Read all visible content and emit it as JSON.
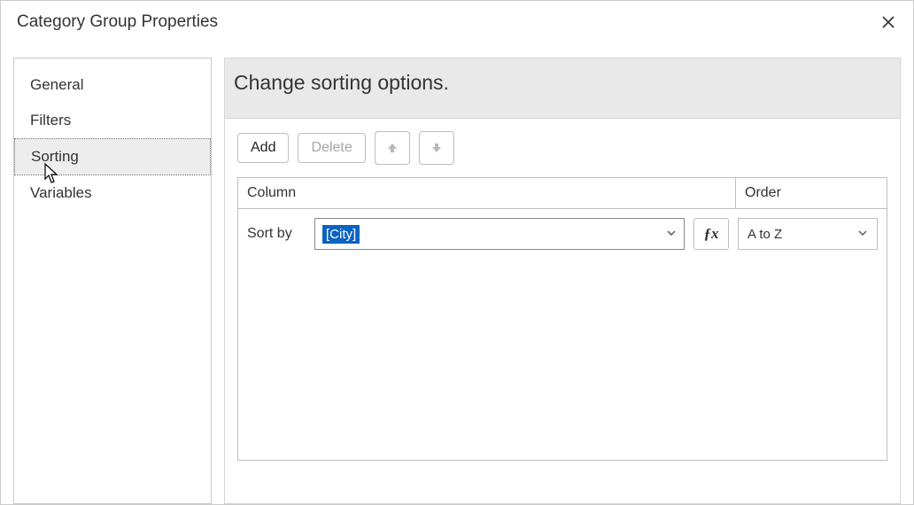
{
  "dialog": {
    "title": "Category Group Properties"
  },
  "sidebar": {
    "items": [
      {
        "label": "General",
        "selected": false
      },
      {
        "label": "Filters",
        "selected": false
      },
      {
        "label": "Sorting",
        "selected": true
      },
      {
        "label": "Variables",
        "selected": false
      }
    ]
  },
  "content": {
    "heading": "Change sorting options.",
    "toolbar": {
      "add": "Add",
      "delete": "Delete"
    },
    "table": {
      "columns": {
        "column": "Column",
        "order": "Order"
      },
      "rows": [
        {
          "label": "Sort by",
          "expression": "[City]",
          "order": "A to Z"
        }
      ]
    }
  },
  "icons": {
    "fx": "ƒx"
  }
}
